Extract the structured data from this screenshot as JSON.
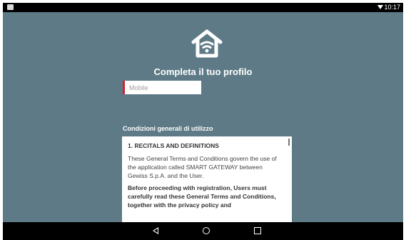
{
  "status_bar": {
    "time": "10:17"
  },
  "screen": {
    "title": "Completa il tuo profilo",
    "mobile_field": {
      "placeholder": "Mobile",
      "value": ""
    },
    "terms_heading": "Condizioni generali di utilizzo",
    "terms": {
      "section_title": "1. RECITALS AND DEFINITIONS",
      "paragraph": "These General Terms and Conditions govern the use of the application called SMART GATEWAY between Gewiss S.p.A. and the User.",
      "bold_paragraph": "Before proceeding with registration, Users must carefully read these General Terms and Conditions, together with the privacy policy and"
    }
  },
  "icons": {
    "status_left": "notification-icon",
    "status_wifi": "wifi-icon",
    "logo": "smart-home-wifi-icon",
    "nav_back": "back-icon",
    "nav_home": "home-icon",
    "nav_recent": "recent-apps-icon"
  },
  "colors": {
    "background": "#5e7a87",
    "accent": "#d1242f"
  }
}
